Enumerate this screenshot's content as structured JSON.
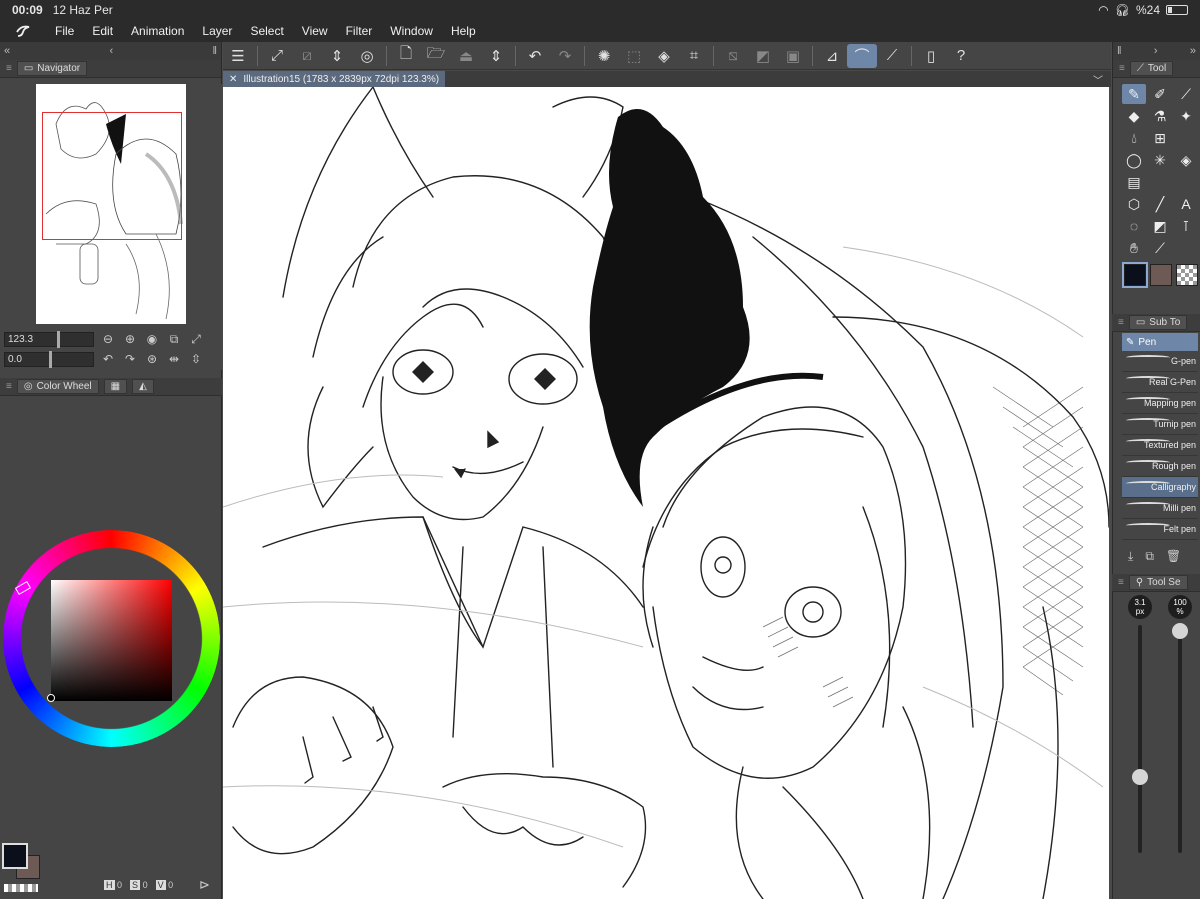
{
  "status": {
    "time": "00:09",
    "date": "12 Haz Per",
    "battery": "%24"
  },
  "menu": [
    "File",
    "Edit",
    "Animation",
    "Layer",
    "Select",
    "View",
    "Filter",
    "Window",
    "Help"
  ],
  "navigator": {
    "tab_label": "Navigator",
    "zoom_value": "123.3",
    "rotate_value": "0.0"
  },
  "color_panel": {
    "tab_label": "Color Wheel",
    "readout": {
      "h_label": "H",
      "h": "0",
      "s_label": "S",
      "s": "0",
      "v_label": "V",
      "v": "0"
    },
    "main_color": "#0b0f1c",
    "sub_color": "#6d5a54"
  },
  "document": {
    "tab_title": "Illustration15 (1783 x 2839px 72dpi 123.3%)"
  },
  "tool_panel": {
    "tab_label": "Tool"
  },
  "sub_tool": {
    "tab_label": "Sub To",
    "group_label": "Pen",
    "items": [
      "G-pen",
      "Real G-Pen",
      "Mapping pen",
      "Turnip pen",
      "Textured pen",
      "Rough pen",
      "Calligraphy",
      "Milli pen",
      "Felt pen"
    ],
    "selected_index": 6
  },
  "tool_settings": {
    "tab_label": "Tool Se",
    "size": "3.1",
    "size_unit": "px",
    "opacity": "100",
    "opacity_unit": "%"
  }
}
